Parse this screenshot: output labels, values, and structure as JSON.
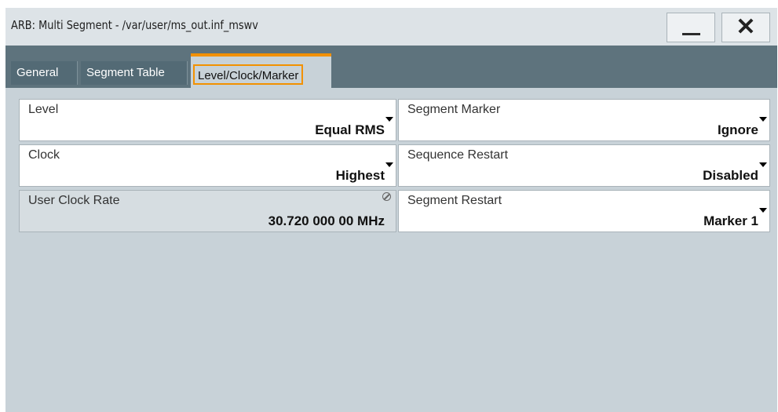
{
  "window": {
    "title": "ARB: Multi Segment - /var/user/ms_out.inf_mswv",
    "minimize_icon": "minimize-icon",
    "close_icon": "close-icon",
    "close_glyph": "✕"
  },
  "tabs": [
    {
      "label": "General",
      "active": false
    },
    {
      "label": "Segment Table",
      "active": false
    },
    {
      "label": "Level/Clock/Marker",
      "active": true
    }
  ],
  "left_fields": [
    {
      "label": "Level",
      "value": "Equal RMS",
      "type": "dropdown"
    },
    {
      "label": "Clock",
      "value": "Highest",
      "type": "dropdown"
    },
    {
      "label": "User Clock Rate",
      "value": "30.720 000 00 MHz",
      "type": "readonly"
    }
  ],
  "right_fields": [
    {
      "label": "Segment Marker",
      "value": "Ignore",
      "type": "dropdown"
    },
    {
      "label": "Sequence Restart",
      "value": "Disabled",
      "type": "dropdown"
    },
    {
      "label": "Segment Restart",
      "value": "Marker 1",
      "type": "dropdown"
    }
  ],
  "colors": {
    "accent": "#f29100",
    "tabbar": "#5e737d",
    "panel": "#c8d2d8"
  }
}
